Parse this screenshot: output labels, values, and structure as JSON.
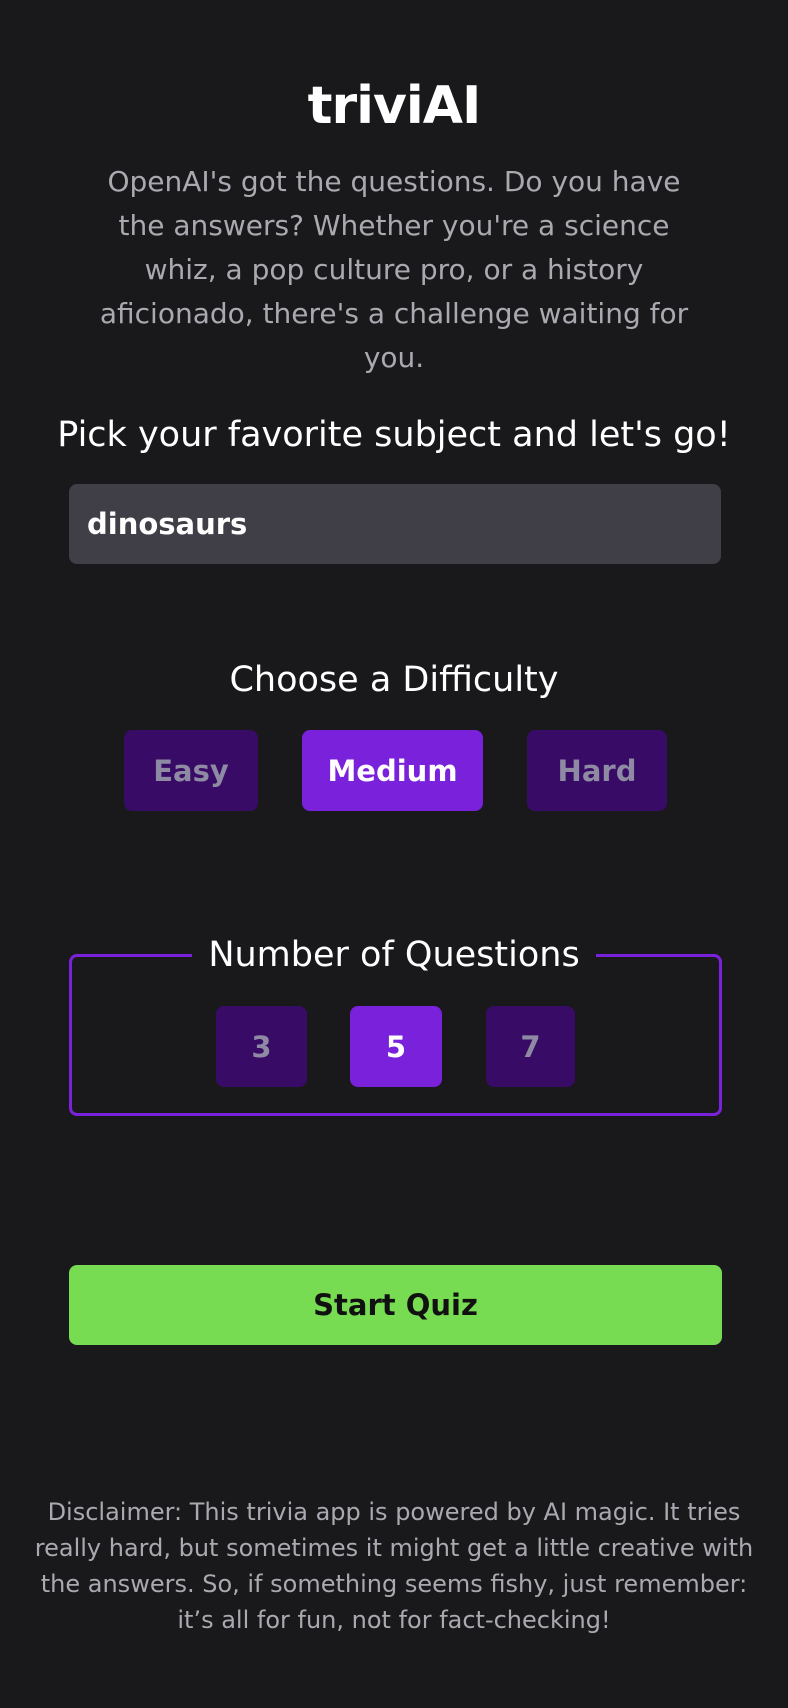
{
  "app": {
    "title": "triviAI",
    "intro": "OpenAI's got the questions. Do you have the answers? Whether you're a science whiz, a pop culture pro, or a history aficionado, there's a challenge waiting for you."
  },
  "subject": {
    "heading": "Pick your favorite subject and let's go!",
    "value": "dinosaurs"
  },
  "difficulty": {
    "heading": "Choose a Difficulty",
    "options": [
      "Easy",
      "Medium",
      "Hard"
    ],
    "selected": "Medium"
  },
  "questions": {
    "heading": "Number of Questions",
    "options": [
      "3",
      "5",
      "7"
    ],
    "selected": "5"
  },
  "start": {
    "label": "Start Quiz"
  },
  "disclaimer": "Disclaimer: This trivia app is powered by AI magic. It tries really hard, but sometimes it might get a little creative with the answers. So, if something seems fishy, just remember: it’s all for fun, not for fact-checking!",
  "colors": {
    "background": "#19191c",
    "accent": "#7a22db",
    "accent_dim": "#380b66",
    "start_button": "#78dc52",
    "input_background": "#403f48"
  }
}
